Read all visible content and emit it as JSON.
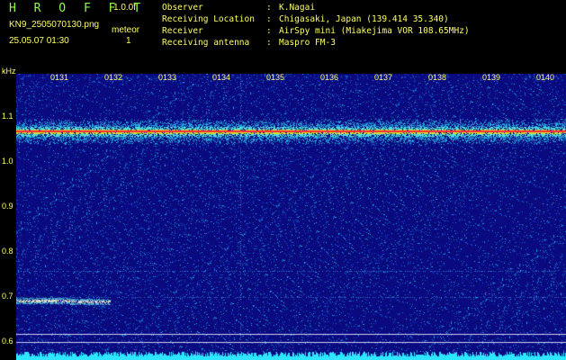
{
  "header": {
    "title": "H R O F F T",
    "version": "1.0.0f",
    "filename": "KN9_2505070130.png",
    "meteor_label": "meteor",
    "meteor_count": "1",
    "datetime": "25.05.07 01:30"
  },
  "info": [
    {
      "key": "Observer",
      "sep": ":",
      "value": "K.Nagai"
    },
    {
      "key": "Receiving Location",
      "sep": ":",
      "value": "Chigasaki, Japan (139.414 35.340)"
    },
    {
      "key": "Receiver",
      "sep": ":",
      "value": "AirSpy mini (Miakejima VOR 108.65MHz)"
    },
    {
      "key": "Receiving antenna",
      "sep": ":",
      "value": "Maspro FM-3"
    }
  ],
  "axis": {
    "unit": "kHz",
    "y_ticks": [
      "1.1",
      "1.0",
      "0.9",
      "0.8",
      "0.7",
      "0.6"
    ],
    "time_ticks": [
      "0131",
      "0132",
      "0133",
      "0134",
      "0135",
      "0136",
      "0137",
      "0138",
      "0139",
      "0140"
    ]
  },
  "colors": {
    "background": "#0a0a7a",
    "carrier": "#ff3030",
    "text": "#ffff66",
    "title": "#8cff4c"
  }
}
